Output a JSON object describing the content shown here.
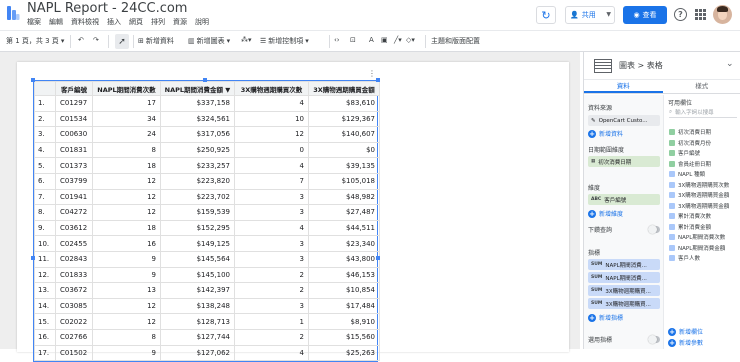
{
  "app": {
    "title": "NAPL Report - 24CC.com",
    "menu": [
      "檔案",
      "編輯",
      "資料檢視",
      "插入",
      "網頁",
      "排列",
      "資源",
      "說明"
    ],
    "share_label": "共用",
    "view_label": "查看",
    "refresh_icon": "refresh-icon",
    "help_icon": "help-icon"
  },
  "toolbar": {
    "page_label": "第 1 頁，共 3 頁",
    "add_data": "新增資料",
    "add_chart": "新增圖表",
    "add_control": "新增控制項",
    "theme": "主題和版面配置"
  },
  "table": {
    "headers": [
      "",
      "客戶編號",
      "NAPL期間消費次數",
      "NAPL期間消費金額 ▼",
      "3X購物週期購買次數",
      "3X購物週期購買金額"
    ],
    "rows": [
      [
        "1.",
        "C01297",
        "17",
        "$337,158",
        "4",
        "$83,610"
      ],
      [
        "2.",
        "C01534",
        "34",
        "$324,561",
        "10",
        "$129,367"
      ],
      [
        "3.",
        "C00630",
        "24",
        "$317,056",
        "12",
        "$140,607"
      ],
      [
        "4.",
        "C01831",
        "8",
        "$250,925",
        "0",
        "$0"
      ],
      [
        "5.",
        "C01373",
        "18",
        "$233,257",
        "4",
        "$39,135"
      ],
      [
        "6.",
        "C03799",
        "12",
        "$223,820",
        "7",
        "$105,018"
      ],
      [
        "7.",
        "C01941",
        "12",
        "$223,702",
        "3",
        "$48,982"
      ],
      [
        "8.",
        "C04272",
        "12",
        "$159,539",
        "3",
        "$27,487"
      ],
      [
        "9.",
        "C03612",
        "18",
        "$152,295",
        "4",
        "$44,511"
      ],
      [
        "10.",
        "C02455",
        "16",
        "$149,125",
        "3",
        "$23,340"
      ],
      [
        "11.",
        "C02843",
        "9",
        "$145,564",
        "3",
        "$43,800"
      ],
      [
        "12.",
        "C01833",
        "9",
        "$145,100",
        "2",
        "$46,153"
      ],
      [
        "13.",
        "C03672",
        "13",
        "$142,397",
        "2",
        "$10,854"
      ],
      [
        "14.",
        "C03085",
        "12",
        "$138,248",
        "3",
        "$17,484"
      ],
      [
        "15.",
        "C02022",
        "12",
        "$128,713",
        "1",
        "$8,910"
      ],
      [
        "16.",
        "C02766",
        "8",
        "$127,744",
        "2",
        "$15,560"
      ],
      [
        "17.",
        "C01502",
        "9",
        "$127,062",
        "4",
        "$25,263"
      ]
    ]
  },
  "panel": {
    "crumb": "圖表 > 表格",
    "tabs": [
      "資料",
      "樣式"
    ],
    "data_source_label": "資料來源",
    "data_source": "OpenCart Custo...",
    "add_data": "新增資料",
    "date_range_label": "日期範圍維度",
    "date_dim": "初次消費日期",
    "dimension_label": "維度",
    "dimension": "客戶編號",
    "add_dimension": "新增維度",
    "drilldown_label": "下鑽查詢",
    "metric_label": "指標",
    "metrics": [
      "NAPL期間消費...",
      "NAPL期間消費...",
      "3X購物週期購買...",
      "3X購物週期購買..."
    ],
    "add_metric": "新增指標",
    "optional_metrics_label": "選用指標",
    "available_fields_label": "可用欄位",
    "search_placeholder": "輸入字詞以搜尋",
    "fields": [
      "初次消費日期",
      "初次消費月份",
      "客戶編號",
      "會員註冊日期",
      "NAPL 種類",
      "3X購物週期購買次數",
      "3X購物週期購買金額",
      "3X購物週期購買金額",
      "累計消費次數",
      "累計消費金額",
      "NAPL期間消費次數",
      "NAPL期間消費金額",
      "客戶人數"
    ],
    "add_field": "新增欄位",
    "add_param": "新增參數"
  }
}
